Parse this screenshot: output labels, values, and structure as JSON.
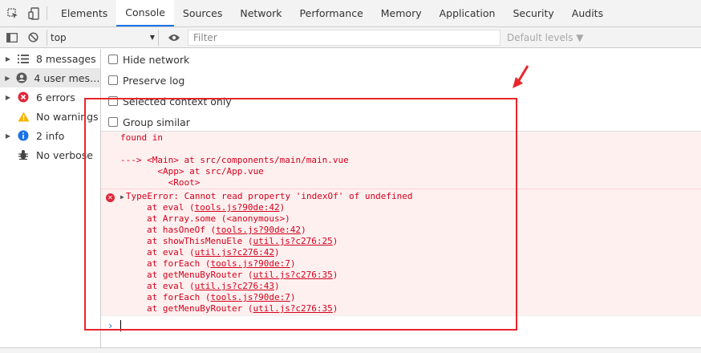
{
  "tabbar": {
    "inspect_icon": "inspect-element-icon",
    "device_icon": "device-toolbar-icon",
    "tabs": [
      {
        "label": "Elements",
        "active": false
      },
      {
        "label": "Console",
        "active": true
      },
      {
        "label": "Sources",
        "active": false
      },
      {
        "label": "Network",
        "active": false
      },
      {
        "label": "Performance",
        "active": false
      },
      {
        "label": "Memory",
        "active": false
      },
      {
        "label": "Application",
        "active": false
      },
      {
        "label": "Security",
        "active": false
      },
      {
        "label": "Audits",
        "active": false
      }
    ]
  },
  "toolbar": {
    "context": "top",
    "filter_placeholder": "Filter",
    "levels": "Default levels ▼"
  },
  "sidebar": {
    "items": [
      {
        "label": "8 messages",
        "icon": "list-icon"
      },
      {
        "label": "4 user mess…",
        "icon": "user-icon"
      },
      {
        "label": "6 errors",
        "icon": "error-icon"
      },
      {
        "label": "No warnings",
        "icon": "warning-icon"
      },
      {
        "label": "2 info",
        "icon": "info-icon"
      },
      {
        "label": "No verbose",
        "icon": "bug-icon"
      }
    ]
  },
  "settings": {
    "hide_network": "Hide network",
    "preserve_log": "Preserve log",
    "selected_context": "Selected context only",
    "group_similar": "Group similar"
  },
  "output": {
    "msg1": {
      "line1": "found in",
      "line2": "",
      "line3": "---> <Main> at src/components/main/main.vue",
      "line4": "       <App> at src/App.vue",
      "line5": "         <Root>"
    },
    "error": {
      "header": "TypeError: Cannot read property 'indexOf' of undefined",
      "stack": [
        {
          "prefix": "at eval (",
          "link": "tools.js?90de:42",
          "suffix": ")"
        },
        {
          "prefix": "at Array.some (<anonymous>)",
          "link": "",
          "suffix": ""
        },
        {
          "prefix": "at hasOneOf (",
          "link": "tools.js?90de:42",
          "suffix": ")"
        },
        {
          "prefix": "at showThisMenuEle (",
          "link": "util.js?c276:25",
          "suffix": ")"
        },
        {
          "prefix": "at eval (",
          "link": "util.js?c276:42",
          "suffix": ")"
        },
        {
          "prefix": "at forEach (",
          "link": "tools.js?90de:7",
          "suffix": ")"
        },
        {
          "prefix": "at getMenuByRouter (",
          "link": "util.js?c276:35",
          "suffix": ")"
        },
        {
          "prefix": "at eval (",
          "link": "util.js?c276:43",
          "suffix": ")"
        },
        {
          "prefix": "at forEach (",
          "link": "tools.js?90de:7",
          "suffix": ")"
        },
        {
          "prefix": "at getMenuByRouter (",
          "link": "util.js?c276:35",
          "suffix": ")"
        }
      ]
    }
  },
  "prompt": {
    "chevron": "›"
  },
  "colors": {
    "error_text": "#d0021b",
    "error_bg": "#fff0f0",
    "annotation": "#e8262a",
    "accent": "#1a73e8"
  }
}
